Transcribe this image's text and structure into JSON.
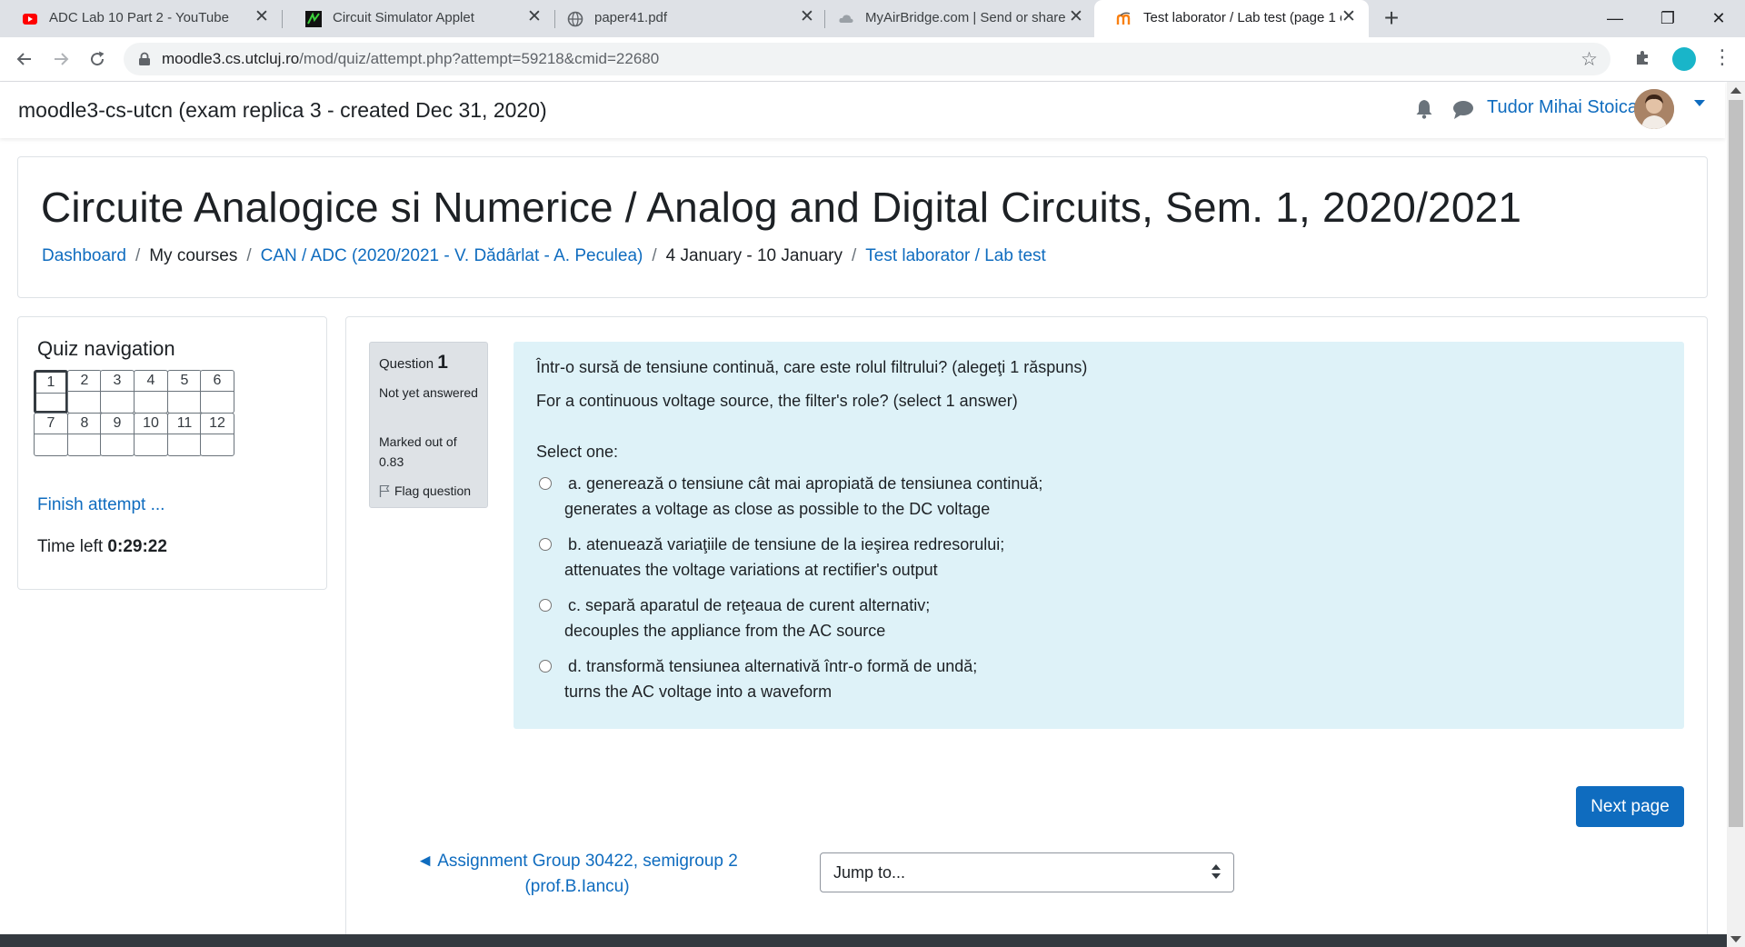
{
  "browser": {
    "tabs": [
      {
        "title": "ADC Lab 10 Part 2 - YouTube",
        "icon": "youtube-icon",
        "active": false
      },
      {
        "title": "Circuit Simulator Applet",
        "icon": "circuit-icon",
        "active": false
      },
      {
        "title": "paper41.pdf",
        "icon": "globe-icon",
        "active": false
      },
      {
        "title": "MyAirBridge.com | Send or share",
        "icon": "cloud-icon",
        "active": false
      },
      {
        "title": "Test laborator / Lab test (page 1 o",
        "icon": "moodle-icon",
        "active": true
      }
    ],
    "new_tab": "+",
    "window_controls": {
      "minimize": "—",
      "restore": "❐",
      "close": "✕"
    },
    "url_host": "moodle3.cs.utcluj.ro",
    "url_path": "/mod/quiz/attempt.php?attempt=59218&cmid=22680"
  },
  "navbar": {
    "site_name": "moodle3-cs-utcn (exam replica 3 - created Dec 31, 2020)",
    "user_name": "Tudor Mihai Stoica"
  },
  "header": {
    "course_title": "Circuite Analogice si Numerice / Analog and Digital Circuits, Sem. 1, 2020/2021",
    "breadcrumb": [
      {
        "label": "Dashboard",
        "link": true
      },
      {
        "label": "My courses",
        "link": false
      },
      {
        "label": "CAN / ADC (2020/2021 - V. Dădârlat - A. Peculea)",
        "link": true
      },
      {
        "label": "4 January - 10 January",
        "link": false
      },
      {
        "label": "Test laborator / Lab test",
        "link": true
      }
    ]
  },
  "quiz_nav": {
    "title": "Quiz navigation",
    "buttons": [
      "1",
      "2",
      "3",
      "4",
      "5",
      "6",
      "7",
      "8",
      "9",
      "10",
      "11",
      "12"
    ],
    "current": "1",
    "finish_label": "Finish attempt ...",
    "time_left_label": "Time left",
    "time_left_value": "0:29:22"
  },
  "question": {
    "label": "Question",
    "number": "1",
    "state": "Not yet answered",
    "grade": "Marked out of 0.83",
    "flag_label": "Flag question",
    "text_ro": "Într-o sursă de tensiune continuă, care este rolul filtrului? (alegeţi 1 răspuns)",
    "text_en": "For a continuous voltage source, the filter's role? (select 1 answer)",
    "select_prompt": "Select one:",
    "answers": [
      {
        "ro": "a. generează o tensiune cât mai apropiată de tensiunea continuă;",
        "en": "generates a voltage as close as possible to the DC voltage"
      },
      {
        "ro": "b. atenuează variaţiile de tensiune de la ieşirea redresorului;",
        "en": "attenuates the voltage variations at rectifier's output"
      },
      {
        "ro": "c. separă aparatul de reţeaua de curent alternativ;",
        "en": "decouples the appliance from the AC source"
      },
      {
        "ro": "d. transformă tensiunea alternativă într-o formă de undă;",
        "en": "turns the AC voltage into a waveform"
      }
    ]
  },
  "footer_nav": {
    "next_label": "Next page",
    "prev_line1": "◄ Assignment Group 30422, semigroup 2",
    "prev_line2": "(prof.B.Iancu)",
    "jump_label": "Jump to..."
  },
  "colors": {
    "link": "#0f6cbf",
    "question_bg": "#def2f8",
    "info_bg": "#dee2e6",
    "primary_button": "#0f6cbf"
  }
}
